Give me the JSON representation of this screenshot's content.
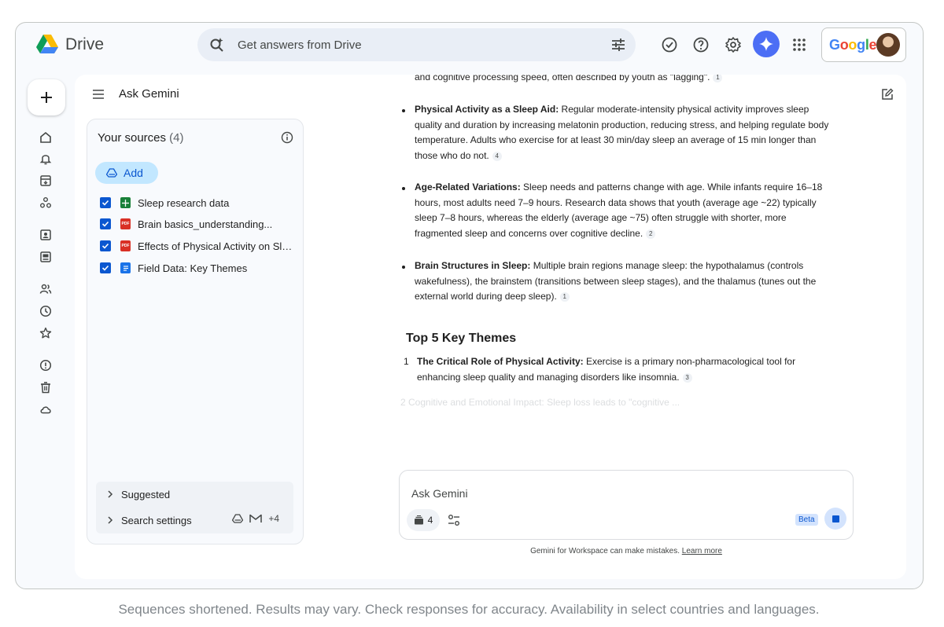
{
  "app": {
    "name": "Drive"
  },
  "search": {
    "placeholder": "Get answers from Drive"
  },
  "account": {
    "brand": "Google"
  },
  "panel": {
    "title": "Ask Gemini"
  },
  "sources": {
    "title": "Your sources",
    "count": "(4)",
    "add_label": "Add",
    "items": [
      {
        "label": "Sleep research data",
        "type": "sheets"
      },
      {
        "label": "Brain basics_understanding...",
        "type": "pdf"
      },
      {
        "label": "Effects of Physical Activity on Slee...",
        "type": "pdf"
      },
      {
        "label": "Field Data: Key Themes",
        "type": "docs"
      }
    ],
    "suggested_label": "Suggested",
    "search_settings_label": "Search settings",
    "extra_count": "+4"
  },
  "response": {
    "p0_text": "and cognitive processing speed, often described by youth as \"lagging\".",
    "p0_cite": "1",
    "b1_title": "Physical Activity as a Sleep Aid:",
    "b1_text": " Regular moderate-intensity physical activity improves sleep quality and duration by increasing melatonin production, reducing stress, and helping regulate body temperature. Adults who exercise for at least 30 min/day sleep an average of 15 min longer than those who do not.",
    "b1_cite": "4",
    "b2_title": "Age-Related Variations:",
    "b2_text": " Sleep needs and patterns change with age. While infants require 16–18 hours, most adults need 7–9 hours. Research data shows that youth (average age ~22) typically sleep 7–8 hours, whereas the elderly (average age ~75) often struggle with shorter, more fragmented sleep and concerns over cognitive decline.",
    "b2_cite": "2",
    "b3_title": "Brain Structures in Sleep:",
    "b3_text": " Multiple brain regions manage sleep: the hypothalamus (controls wakefulness), the brainstem (transitions between sleep stages), and the thalamus (tunes out the external world during deep sleep).",
    "b3_cite": "1",
    "heading": "Top 5 Key Themes",
    "n1_num": "1",
    "n1_title": "The Critical Role of Physical Activity:",
    "n1_text": " Exercise is a primary non-pharmacological tool for enhancing sleep quality and managing disorders like insomnia.",
    "n1_cite": "3",
    "n2_faded": "2   Cognitive and Emotional Impact: Sleep loss leads to \"cognitive ..."
  },
  "input": {
    "placeholder": "Ask Gemini",
    "source_count": "4",
    "beta": "Beta"
  },
  "disclaimer": {
    "text": "Gemini for Workspace can make mistakes.",
    "link": "Learn more"
  },
  "caption": "Sequences shortened. Results may vary. Check responses for accuracy. Availability in select countries and languages.",
  "colors": {
    "accent": "#0b57d0",
    "gemini": "#4c6ef5",
    "chip": "#c2e7ff"
  }
}
